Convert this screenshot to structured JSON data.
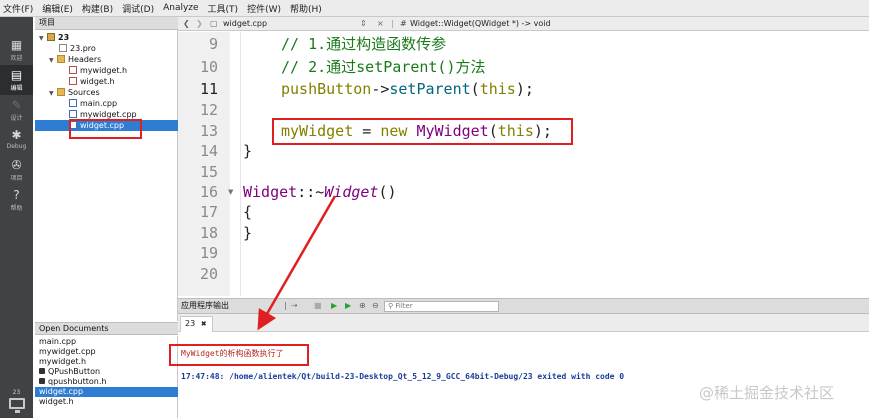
{
  "menu": [
    "文件(F)",
    "编辑(E)",
    "构建(B)",
    "调试(D)",
    "Analyze",
    "工具(T)",
    "控件(W)",
    "帮助(H)"
  ],
  "modes": {
    "welcome": "欢迎",
    "edit": "编辑",
    "design": "设计",
    "debug": "Debug",
    "projects": "项目",
    "help": "帮助",
    "kit_number": "23"
  },
  "project_panel": {
    "title": "项目",
    "tree": {
      "project": "23",
      "pro_file": "23.pro",
      "headers_folder": "Headers",
      "headers": [
        "mywidget.h",
        "widget.h"
      ],
      "sources_folder": "Sources",
      "sources": [
        "main.cpp",
        "mywidget.cpp",
        "widget.cpp"
      ]
    }
  },
  "open_documents": {
    "title": "Open Documents",
    "items": [
      "main.cpp",
      "mywidget.cpp",
      "mywidget.h",
      "QPushButton",
      "qpushbutton.h",
      "widget.cpp",
      "widget.h"
    ]
  },
  "editor_toolbar": {
    "file_name": "widget.cpp",
    "function_crumb": "Widget::Widget(QWidget *) -> void",
    "close": "×"
  },
  "editor": {
    "line_numbers": [
      "9",
      "10",
      "11",
      "12",
      "13",
      "14",
      "15",
      "16",
      "17",
      "18",
      "19",
      "20"
    ],
    "current_line": "11"
  },
  "output": {
    "title": "应用程序输出",
    "filter_placeholder": "Filter",
    "tab_label": "23",
    "tab_close": "✖",
    "line1": "MyWidget的析构函数执行了",
    "line2": "17:47:48: /home/alientek/Qt/build-23-Desktop_Qt_5_12_9_GCC_64bit-Debug/23 exited with code 0"
  },
  "watermark": "@稀土掘金技术社区",
  "colors": {
    "annotation_red": "#e02020",
    "selection_blue": "#2f7cd3",
    "comment_green": "#1b7a1b",
    "keyword_olive": "#808000",
    "class_purple": "#800080"
  }
}
